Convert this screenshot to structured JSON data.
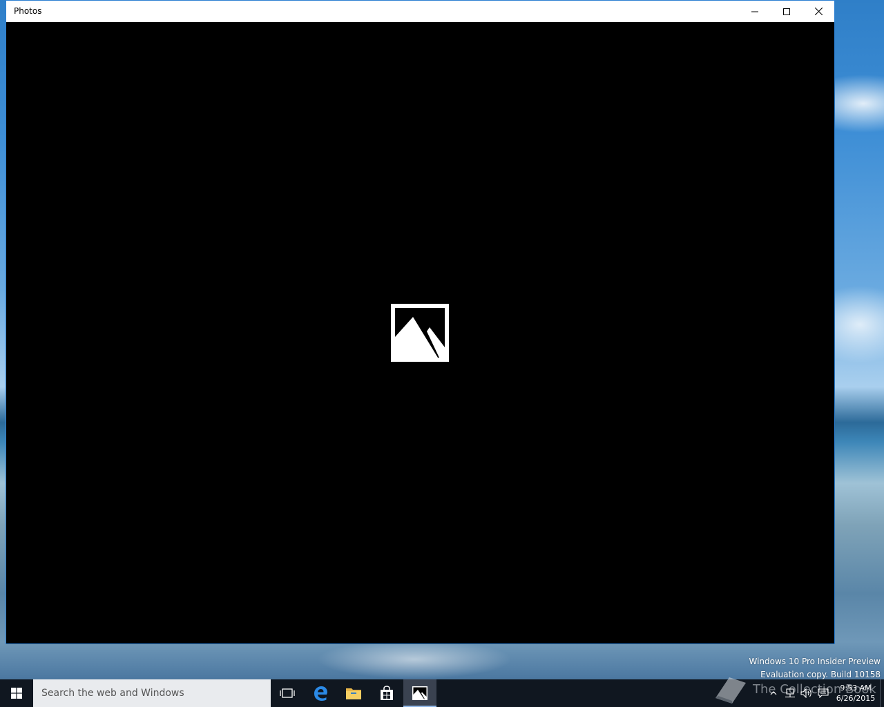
{
  "window": {
    "title": "Photos",
    "controls": {
      "minimize_icon": "minimize-icon",
      "maximize_icon": "maximize-icon",
      "close_icon": "close-icon"
    },
    "content": {
      "placeholder_icon": "image-placeholder-icon"
    },
    "accent_color": "#2b7fd1"
  },
  "watermark": {
    "line1": "Windows 10 Pro Insider Preview",
    "line2": "Evaluation copy. Build 10158"
  },
  "taskbar": {
    "search_placeholder": "Search the web and Windows",
    "pinned": [
      {
        "name": "task-view-icon"
      },
      {
        "name": "edge-icon"
      },
      {
        "name": "file-explorer-icon"
      },
      {
        "name": "store-icon"
      },
      {
        "name": "photos-icon",
        "active": true
      }
    ],
    "brand_text": "The Collection Book",
    "clock": {
      "time": "9:53 AM",
      "date": "6/26/2015"
    }
  }
}
